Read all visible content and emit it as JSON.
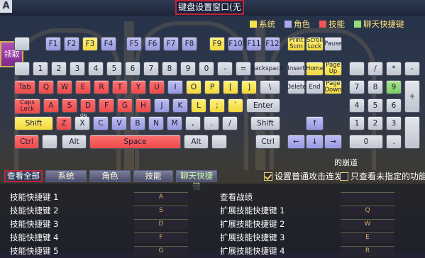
{
  "window": {
    "title": "键盘设置窗口(无",
    "corner_label": "A"
  },
  "legend": [
    {
      "label": "系统",
      "color": "#f4e34b"
    },
    {
      "label": "角色",
      "color": "#aaa9ef"
    },
    {
      "label": "技能",
      "color": "#f05555"
    },
    {
      "label": "聊天快捷键",
      "color": "#96dc7a"
    }
  ],
  "claim_button": "领取",
  "keys": {
    "row0": [
      "F1",
      "F2",
      "F3",
      "F4",
      "F5",
      "F6",
      "F7",
      "F8",
      "F9",
      "F10",
      "F11",
      "F12"
    ],
    "sys_top": [
      "Print Scrn",
      "Scroll Lock",
      "Pause"
    ],
    "row1": [
      "1",
      "2",
      "3",
      "4",
      "5",
      "6",
      "7",
      "8",
      "9",
      "0",
      "-",
      "=",
      "backspace"
    ],
    "ins": [
      "Insert",
      "Home",
      "Page Up"
    ],
    "num_top": [
      "/",
      "*",
      "-"
    ],
    "row2": [
      "Tab",
      "Q",
      "W",
      "E",
      "R",
      "T",
      "Y",
      "U",
      "I",
      "O",
      "P",
      "[",
      "]",
      "\\"
    ],
    "del": [
      "Delete",
      "End",
      "Page Down"
    ],
    "num2": [
      "7",
      "8",
      "9",
      "+"
    ],
    "row3": [
      "Caps Lock",
      "A",
      "S",
      "D",
      "F",
      "G",
      "H",
      "J",
      "K",
      "L",
      ";",
      "`",
      "Enter"
    ],
    "num3": [
      "4",
      "5",
      "6"
    ],
    "row4": [
      "Shift",
      "Z",
      "X",
      "C",
      "V",
      "B",
      "N",
      "M",
      ",",
      ".",
      "/",
      "Shift"
    ],
    "x_tag": "ON",
    "num4": [
      "1",
      "2",
      "3"
    ],
    "row5": [
      "Ctrl",
      "Alt",
      "Space",
      "Alt",
      "Ctrl"
    ],
    "arrows": [
      "↑",
      "←",
      "↓",
      "→"
    ],
    "num5": [
      "0",
      "."
    ]
  },
  "dungeon_label": "的崩道",
  "tabs": [
    "查看全部",
    "系统",
    "角色",
    "技能",
    "聊天快捷键"
  ],
  "options": {
    "opt1": "设置普通攻击连发",
    "opt1_checked": true,
    "opt2": "只查看未指定的功能",
    "opt2_checked": false
  },
  "list_left": [
    {
      "label": "技能快捷键 1",
      "key": "A"
    },
    {
      "label": "技能快捷键 2",
      "key": "S"
    },
    {
      "label": "技能快捷键 3",
      "key": "D"
    },
    {
      "label": "技能快捷键 4",
      "key": "F"
    },
    {
      "label": "技能快捷键 5",
      "key": "G"
    }
  ],
  "list_right": [
    {
      "label": "查看战绩",
      "key": ""
    },
    {
      "label": "扩展技能快捷键 1",
      "key": "Q"
    },
    {
      "label": "扩展技能快捷键 2",
      "key": "W"
    },
    {
      "label": "扩展技能快捷键 3",
      "key": "E"
    },
    {
      "label": "扩展技能快捷键 4",
      "key": "R"
    }
  ]
}
